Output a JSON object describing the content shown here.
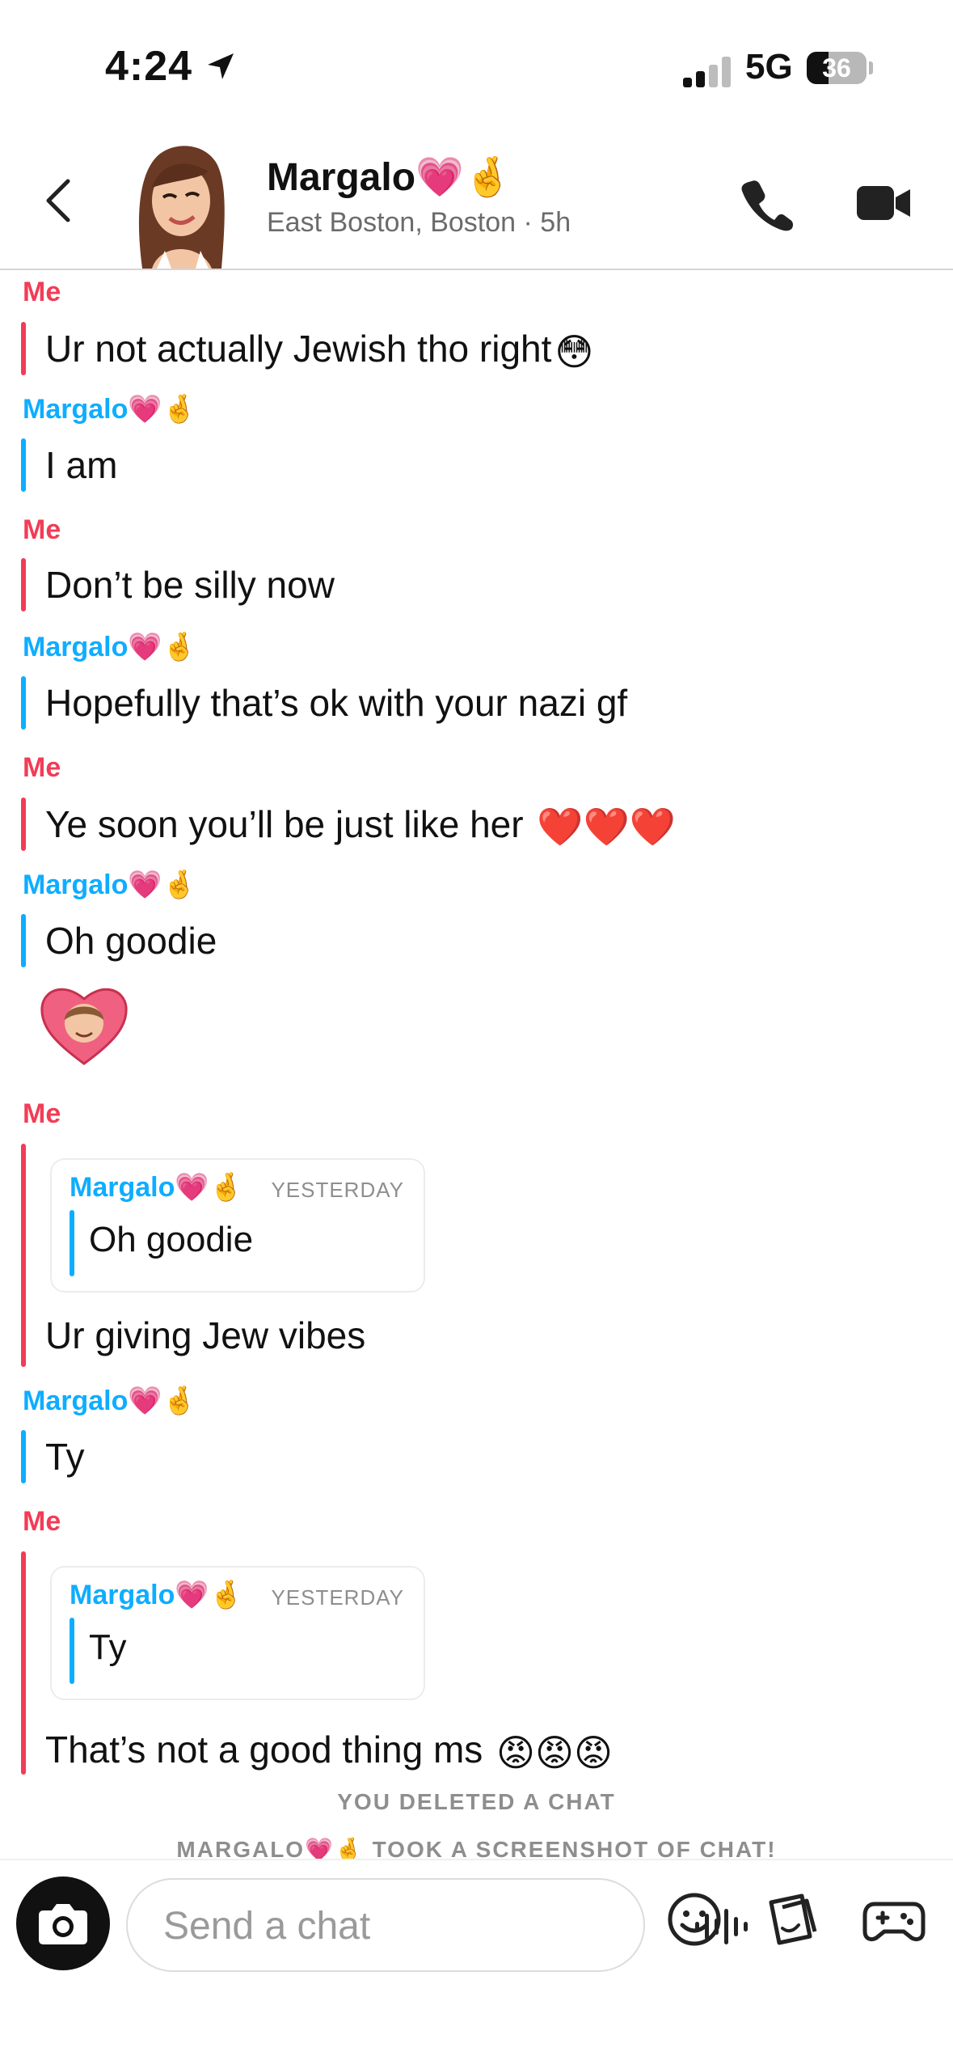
{
  "status_bar": {
    "time": "4:24",
    "network": "5G",
    "battery": "36",
    "battery_level": 0.36
  },
  "header": {
    "back_icon": "chevron-left-icon",
    "contact_name": "Margalo💗🤞",
    "location": "East Boston, Boston · 5h",
    "call_icon": "phone-icon",
    "video_icon": "video-camera-icon"
  },
  "messages": [
    {
      "sender": "Me",
      "text": "Ur not actually Jewish tho right",
      "emoji": "😳"
    },
    {
      "sender": "Margalo💗🤞",
      "text": "I am"
    },
    {
      "sender": "Me",
      "text": "Don’t be silly now"
    },
    {
      "sender": "Margalo💗🤞",
      "text": "Hopefully that’s ok with your nazi gf"
    },
    {
      "sender": "Me",
      "text": "Ye soon you’ll be just like her",
      "emoji": "❤️❤️❤️"
    },
    {
      "sender": "Margalo💗🤞",
      "text": "Oh goodie"
    },
    {
      "sender": "Me",
      "text": "Ur giving Jew vibes",
      "quote": {
        "name": "Margalo💗🤞",
        "time": "YESTERDAY",
        "text": "Oh goodie"
      }
    },
    {
      "sender": "Margalo💗🤞",
      "text": "Ty"
    },
    {
      "sender": "Me",
      "text": "That’s not a good thing ms",
      "emoji": "😡😡😡",
      "quote": {
        "name": "Margalo💗🤞",
        "time": "YESTERDAY",
        "text": "Ty"
      }
    }
  ],
  "system_notices": [
    "YOU DELETED A CHAT",
    "MARGALO💗🤞 TOOK A SCREENSHOT OF CHAT!"
  ],
  "input": {
    "placeholder": "Send a chat",
    "icons": [
      "camera-icon",
      "voice-icon",
      "emoji-icon",
      "sticker-icon",
      "game-controller-icon"
    ]
  },
  "colors": {
    "me": "#f23c57",
    "friend": "#0eadff",
    "muted": "#8e8e8e"
  }
}
